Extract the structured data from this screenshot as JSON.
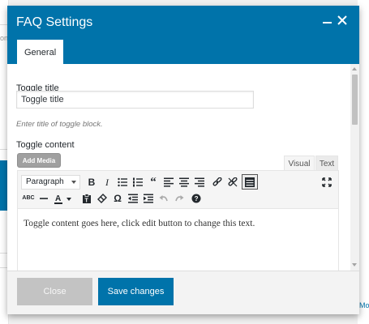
{
  "dialog": {
    "title": "FAQ Settings",
    "tab": "General"
  },
  "form": {
    "title_label": "Toggle title",
    "title_value": "Toggle title",
    "title_hint": "Enter title of toggle block.",
    "content_label": "Toggle content",
    "add_media": "Add Media"
  },
  "editor": {
    "tab_visual": "Visual",
    "tab_text": "Text",
    "format_select": "Paragraph",
    "body_text": "Toggle content goes here, click edit button to change this text.",
    "toolbar_row1": [
      "bold-icon",
      "italic-icon",
      "bullet-list-icon",
      "numbered-list-icon",
      "blockquote-icon",
      "align-left-icon",
      "align-center-icon",
      "align-right-icon",
      "link-icon",
      "unlink-icon",
      "toolbar-toggle-icon",
      "fullscreen-icon"
    ],
    "toolbar_row2": [
      "strikethrough-icon",
      "horizontal-rule-icon",
      "text-color-icon",
      "paste-text-icon",
      "clear-formatting-icon",
      "special-character-icon",
      "outdent-icon",
      "indent-icon",
      "undo-icon",
      "redo-icon",
      "help-icon"
    ]
  },
  "footer": {
    "close_label": "Close",
    "save_label": "Save changes"
  },
  "colors": {
    "accent": "#0073aa",
    "disabled_button": "#c3c3c3"
  },
  "background": {
    "left_fragment": "on",
    "right_fragment": "Mov"
  }
}
